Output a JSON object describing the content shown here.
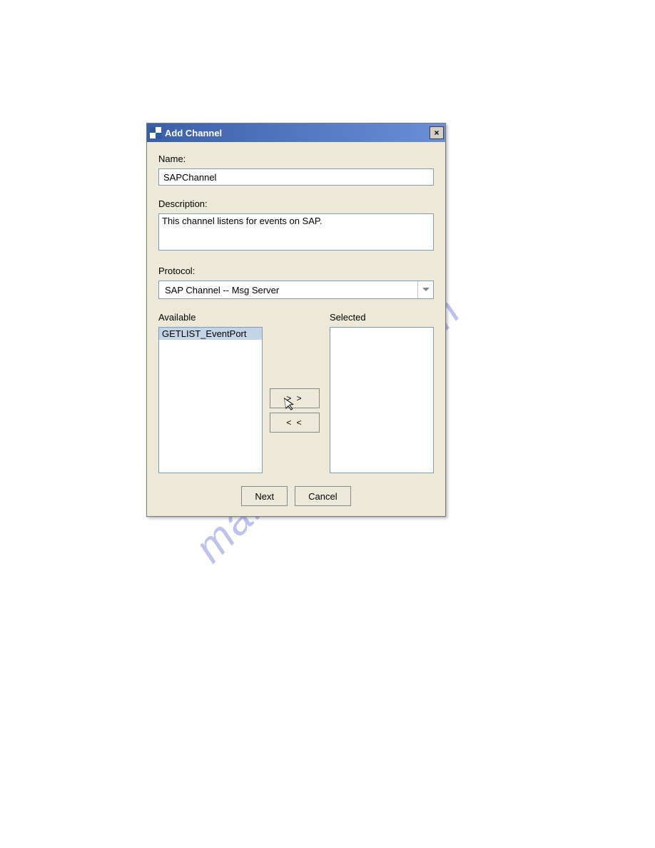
{
  "dialog": {
    "title": "Add Channel",
    "close_icon": "×",
    "fields": {
      "name": {
        "label": "Name:",
        "value": "SAPChannel"
      },
      "description": {
        "label": "Description:",
        "value": "This channel listens for events on SAP."
      },
      "protocol": {
        "label": "Protocol:",
        "value": "SAP Channel -- Msg Server"
      }
    },
    "lists": {
      "available": {
        "label": "Available",
        "items": [
          "GETLIST_EventPort"
        ]
      },
      "selected": {
        "label": "Selected",
        "items": []
      }
    },
    "transfer": {
      "add": "> >",
      "remove": "< <"
    },
    "buttons": {
      "next": "Next",
      "cancel": "Cancel"
    }
  },
  "watermark": "manualshive.com"
}
